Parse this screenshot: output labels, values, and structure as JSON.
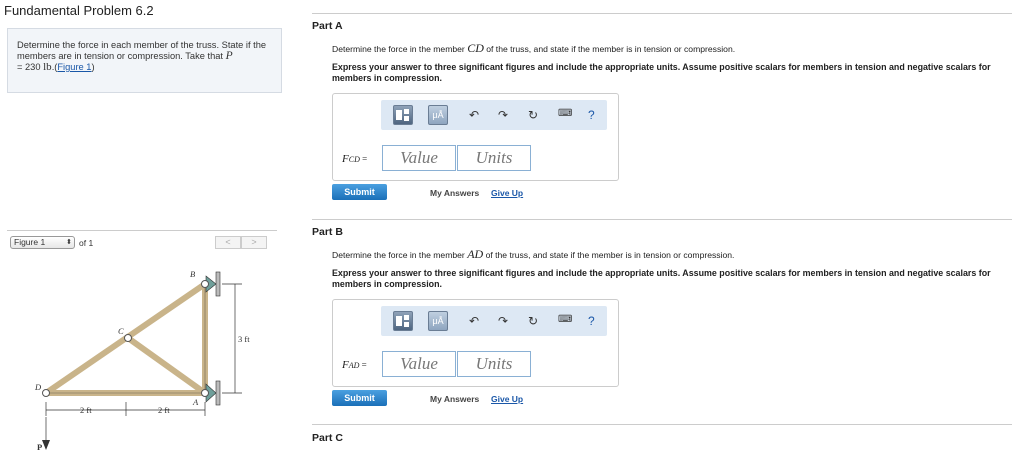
{
  "header": {
    "title": "Fundamental Problem 6.2"
  },
  "problem": {
    "text": "Determine the force in each member of the truss. State if the members are in tension or compression. Take that",
    "p_symbol": "P",
    "p_value": "= 230",
    "p_unit": "lb",
    "figure_link": "Figure 1",
    "link_prefix": ".(",
    "link_suffix": ")"
  },
  "figure_panel": {
    "select_value": "Figure 1",
    "of_label": "of 1",
    "prev": "<",
    "next": ">"
  },
  "truss_labels": {
    "b": "B",
    "c": "C",
    "d": "D",
    "a": "A",
    "p": "P",
    "height": "3 ft",
    "span1": "2 ft",
    "span2": "2 ft"
  },
  "parts": [
    {
      "label": "Part A",
      "question_pre": "Determine the force in the member",
      "member": "CD",
      "question_post": "of the truss, and state if the member is in tension or compression.",
      "instruction": "Express your answer to three significant figures and include the appropriate units. Assume positive scalars for members in tension and negative scalars for members in compression.",
      "answer_symbol": "F",
      "answer_sub": "CD",
      "eq": " =",
      "value_placeholder": "Value",
      "units_placeholder": "Units",
      "submit": "Submit",
      "my_answers": "My Answers",
      "give_up": "Give Up"
    },
    {
      "label": "Part B",
      "question_pre": "Determine the force in the member",
      "member": "AD",
      "question_post": "of the truss, and state if the member is in tension or compression.",
      "instruction": "Express your answer to three significant figures and include the appropriate units. Assume positive scalars for members in tension and negative scalars for members in compression.",
      "answer_symbol": "F",
      "answer_sub": "AD",
      "eq": " =",
      "value_placeholder": "Value",
      "units_placeholder": "Units",
      "submit": "Submit",
      "my_answers": "My Answers",
      "give_up": "Give Up"
    },
    {
      "label": "Part C"
    }
  ],
  "toolbar": {
    "icons": [
      "template-icon",
      "units-mu-icon",
      "undo-icon",
      "redo-icon",
      "reset-icon",
      "keyboard-icon",
      "help-icon"
    ],
    "mu_label": "μÅ",
    "help_label": "?"
  }
}
